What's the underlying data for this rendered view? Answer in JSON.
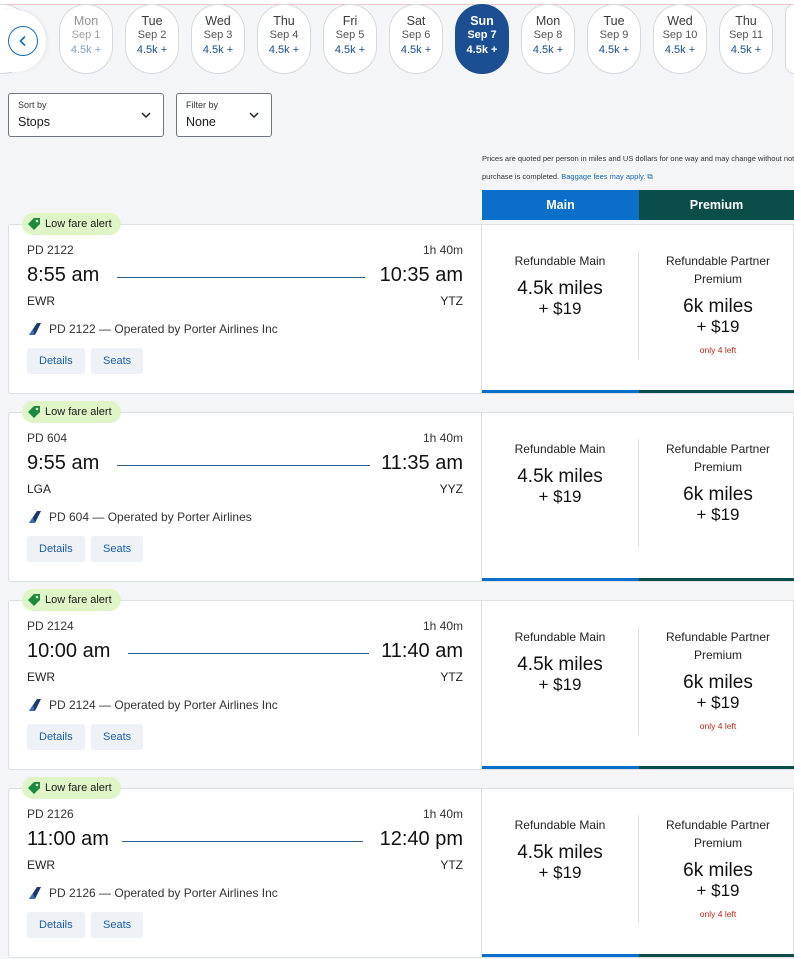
{
  "dates": [
    {
      "dow": "Mon",
      "md": "Sep 1",
      "price": "4.5k +"
    },
    {
      "dow": "Tue",
      "md": "Sep 2",
      "price": "4.5k +"
    },
    {
      "dow": "Wed",
      "md": "Sep 3",
      "price": "4.5k +"
    },
    {
      "dow": "Thu",
      "md": "Sep 4",
      "price": "4.5k +"
    },
    {
      "dow": "Fri",
      "md": "Sep 5",
      "price": "4.5k +"
    },
    {
      "dow": "Sat",
      "md": "Sep 6",
      "price": "4.5k +"
    },
    {
      "dow": "Sun",
      "md": "Sep 7",
      "price": "4.5k +"
    },
    {
      "dow": "Mon",
      "md": "Sep 8",
      "price": "4.5k +"
    },
    {
      "dow": "Tue",
      "md": "Sep 9",
      "price": "4.5k +"
    },
    {
      "dow": "Wed",
      "md": "Sep 10",
      "price": "4.5k +"
    },
    {
      "dow": "Thu",
      "md": "Sep 11",
      "price": "4.5k +"
    }
  ],
  "selected_date": "Sep 7",
  "sort": {
    "label": "Sort by",
    "value": "Stops"
  },
  "filter": {
    "label": "Filter by",
    "value": "None"
  },
  "notice": {
    "line1": "Prices are quoted per person in miles and US dollars for one way and may change without notice",
    "line2": "purchase is completed.",
    "link": "Baggage fees may apply."
  },
  "tabs": {
    "main": "Main",
    "premium": "Premium"
  },
  "colors": {
    "main": "#0a6fc9",
    "premium": "#0b4d49",
    "selected_date": "#1b4f92",
    "low_fare": "#dff5c7",
    "seats_left": "#b82a12"
  },
  "flights": [
    {
      "badge": "Low fare alert",
      "flight_number": "PD 2122",
      "duration": "1h 40m",
      "depart": "8:55 am",
      "arrive": "10:35 am",
      "origin": "EWR",
      "destination": "YTZ",
      "operator": "PD 2122 — Operated by Porter Airlines Inc",
      "details": "Details",
      "seats": "Seats",
      "fare_main": {
        "name": "Refundable Main",
        "miles": "4.5k miles",
        "usd": "+ $19"
      },
      "fare_premium": {
        "name1": "Refundable Partner",
        "name2": "Premium",
        "miles": "6k miles",
        "usd": "+ $19",
        "left": "only 4 left"
      }
    },
    {
      "badge": "Low fare alert",
      "flight_number": "PD 604",
      "duration": "1h 40m",
      "depart": "9:55 am",
      "arrive": "11:35 am",
      "origin": "LGA",
      "destination": "YYZ",
      "operator": "PD 604 — Operated by Porter Airlines",
      "details": "Details",
      "seats": "Seats",
      "fare_main": {
        "name": "Refundable Main",
        "miles": "4.5k miles",
        "usd": "+ $19"
      },
      "fare_premium": {
        "name1": "Refundable Partner",
        "name2": "Premium",
        "miles": "6k miles",
        "usd": "+ $19",
        "left": ""
      }
    },
    {
      "badge": "Low fare alert",
      "flight_number": "PD 2124",
      "duration": "1h 40m",
      "depart": "10:00 am",
      "arrive": "11:40 am",
      "origin": "EWR",
      "destination": "YTZ",
      "operator": "PD 2124 — Operated by Porter Airlines Inc",
      "details": "Details",
      "seats": "Seats",
      "fare_main": {
        "name": "Refundable Main",
        "miles": "4.5k miles",
        "usd": "+ $19"
      },
      "fare_premium": {
        "name1": "Refundable Partner",
        "name2": "Premium",
        "miles": "6k miles",
        "usd": "+ $19",
        "left": "only 4 left"
      }
    },
    {
      "badge": "Low fare alert",
      "flight_number": "PD 2126",
      "duration": "1h 40m",
      "depart": "11:00 am",
      "arrive": "12:40 pm",
      "origin": "EWR",
      "destination": "YTZ",
      "operator": "PD 2126 — Operated by Porter Airlines Inc",
      "details": "Details",
      "seats": "Seats",
      "fare_main": {
        "name": "Refundable Main",
        "miles": "4.5k miles",
        "usd": "+ $19"
      },
      "fare_premium": {
        "name1": "Refundable Partner",
        "name2": "Premium",
        "miles": "6k miles",
        "usd": "+ $19",
        "left": "only 4 left"
      }
    }
  ]
}
